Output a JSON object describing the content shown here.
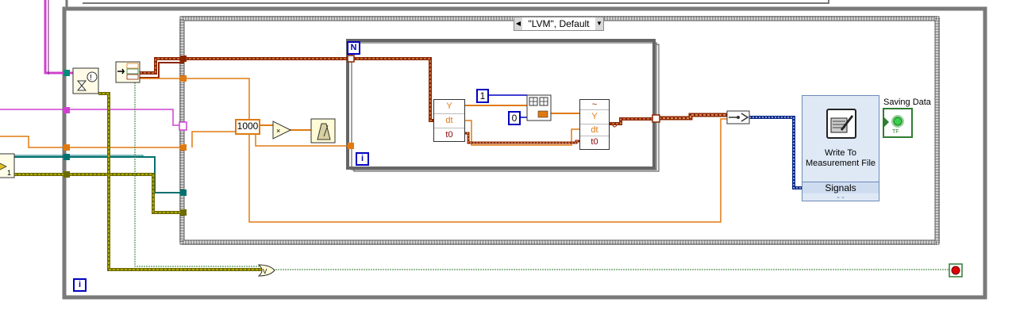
{
  "case_structure": {
    "selector_label": "\"LVM\", Default"
  },
  "constants": {
    "thousand": "1000",
    "one": "1",
    "zero": "0"
  },
  "loop_terminals": {
    "for_loop_count": "N",
    "for_loop_iteration": "i",
    "while_loop_iteration": "i"
  },
  "get_components": {
    "y": "Y",
    "dt": "dt",
    "t0": "t0"
  },
  "build_waveform": {
    "y": "Y",
    "dt": "dt",
    "t0": "t0"
  },
  "write_to_file": {
    "title": "Write To Measurement File",
    "input_label": "Signals"
  },
  "indicator": {
    "label": "Saving Data",
    "led_color": "#39d04a",
    "tf_text": "TF"
  },
  "left_constant": "1",
  "colors": {
    "orange_wire": "#e07a10",
    "brown_wire": "#8b2500",
    "pink_wire": "#d040d0",
    "teal_wire": "#007070",
    "olive_wire": "#6b6b00",
    "green_wire": "#2e7d32",
    "blue_wire": "#0000c0",
    "frame_gray": "#7a7a7a"
  }
}
